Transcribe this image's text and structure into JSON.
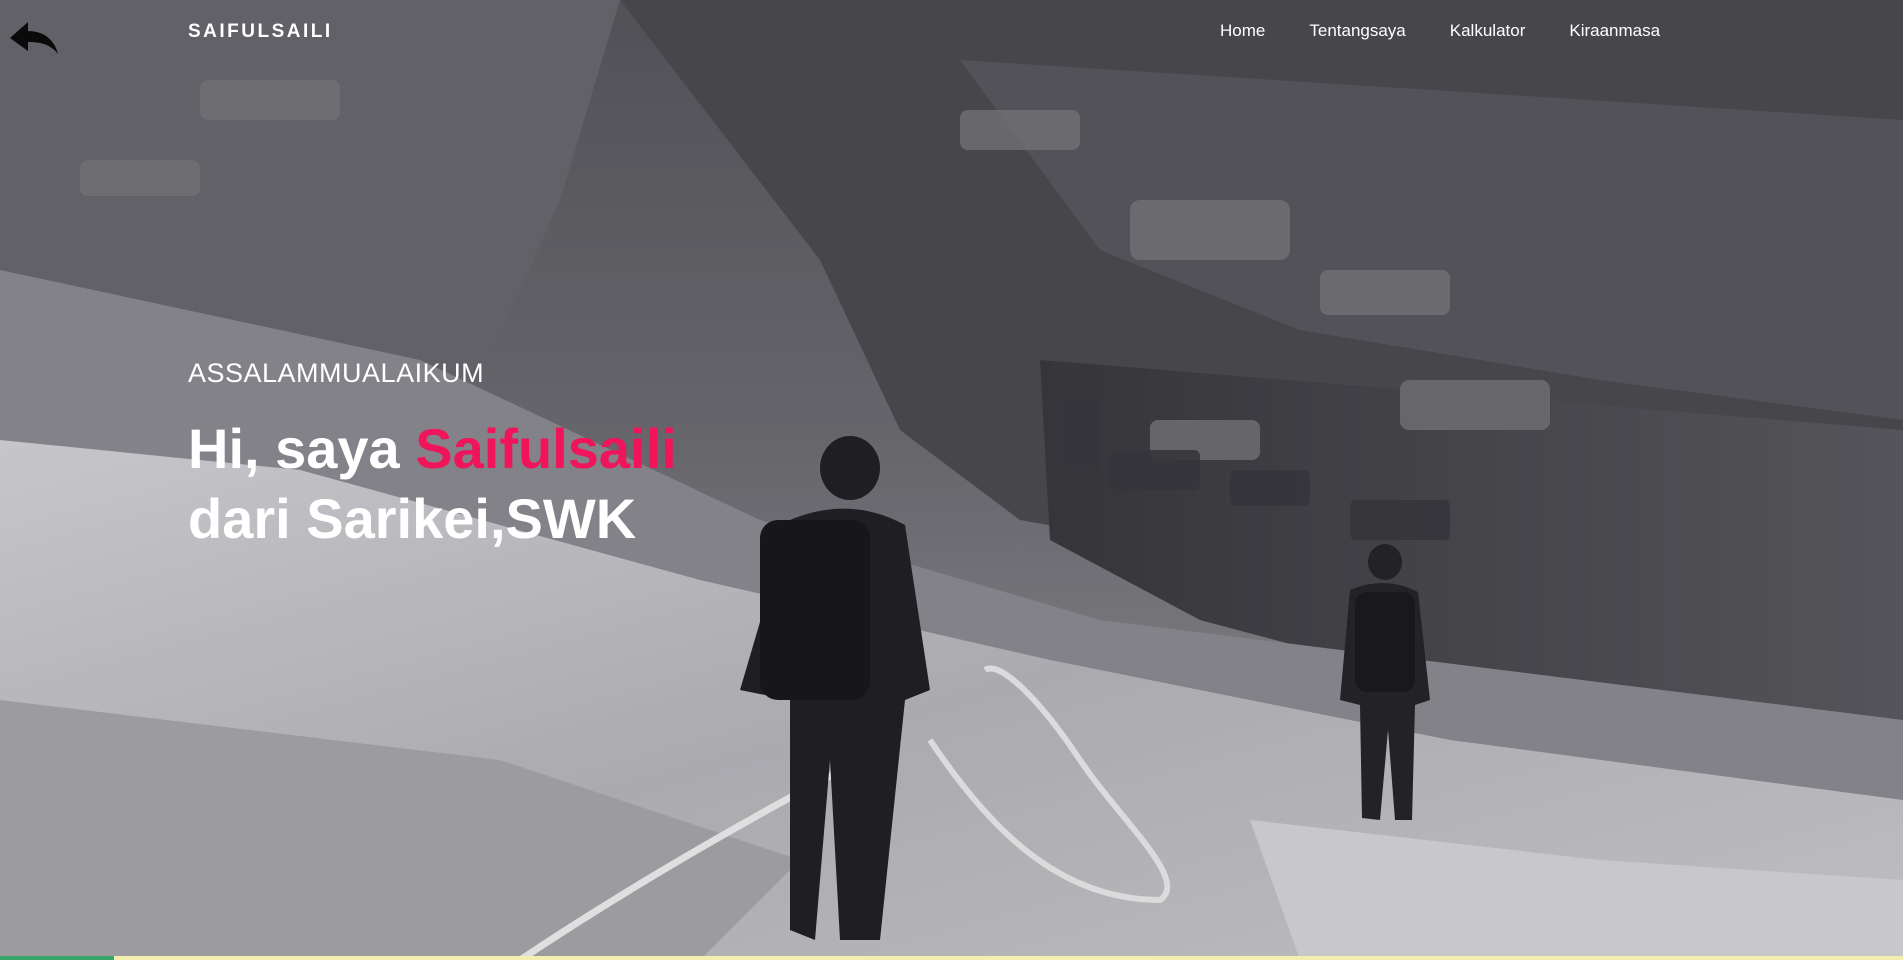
{
  "header": {
    "brand": "SAIFULSAILI",
    "back_icon": "back-arrow-icon",
    "nav": [
      {
        "label": "Home"
      },
      {
        "label": "Tentangsaya"
      },
      {
        "label": "Kalkulator"
      },
      {
        "label": "Kiraanmasa"
      }
    ]
  },
  "hero": {
    "greeting": "ASSALAMMUALAIKUM",
    "headline_prefix": "Hi, saya",
    "headline_name": "Saifulsaili",
    "headline_line2": "dari Sarikei,SWK",
    "background": "grayscale photo of two hikers on a rocky mountain slope with a rope"
  },
  "colors": {
    "accent": "#f0145a",
    "text": "#ffffff",
    "bottom_bar": "#f4eeb0",
    "bottom_progress": "#39a56a"
  },
  "page_progress": 0.06
}
